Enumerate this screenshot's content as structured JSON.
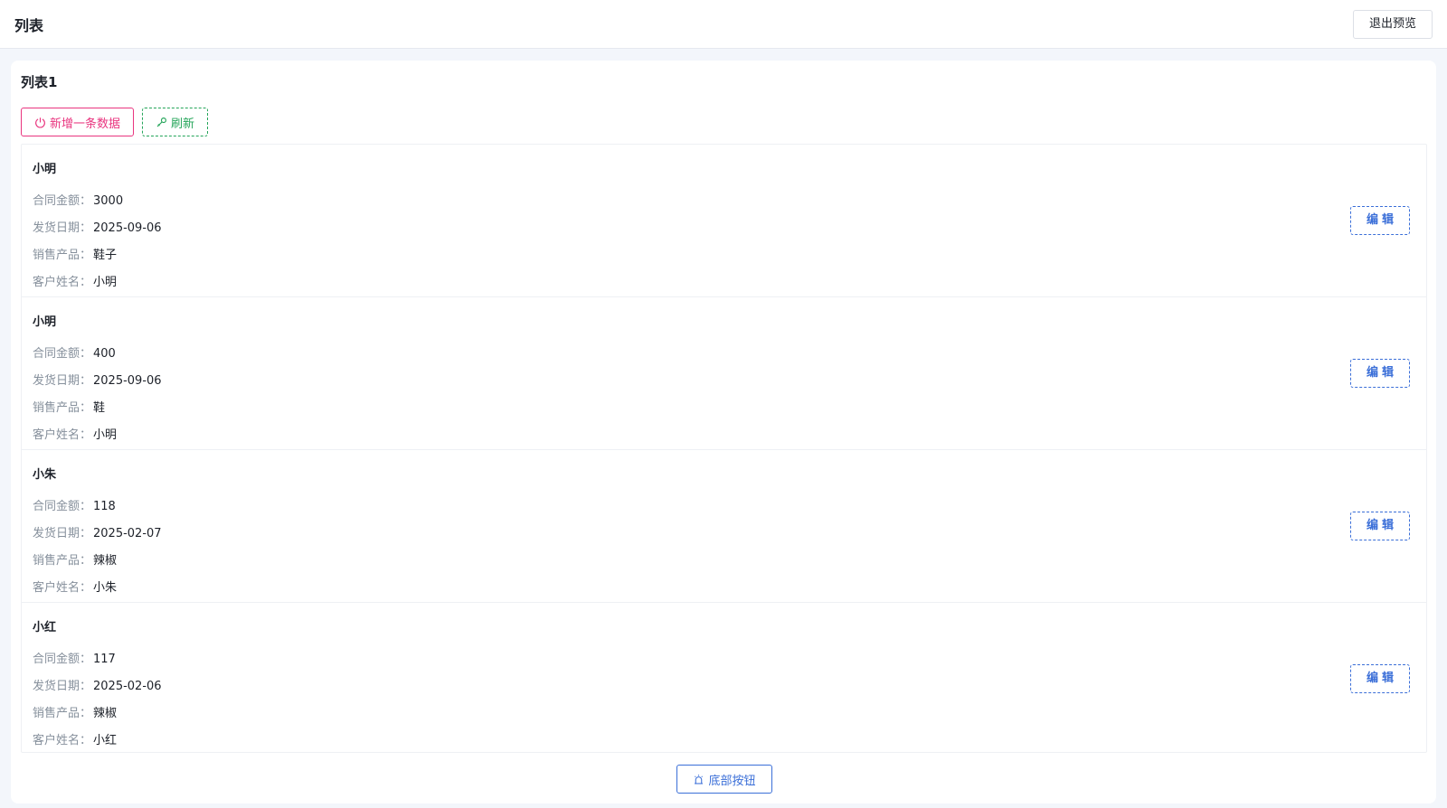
{
  "header": {
    "title": "列表",
    "exit_label": "退出预览"
  },
  "panel": {
    "title": "列表1",
    "add_label": "新增一条数据",
    "refresh_label": "刷新",
    "bottom_label": "底部按钮",
    "edit_label": "编辑"
  },
  "field_labels": {
    "amount": "合同金额：",
    "date": "发货日期：",
    "product": "销售产品：",
    "customer": "客户姓名："
  },
  "items": [
    {
      "name": "小明",
      "amount": "3000",
      "date": "2025-09-06",
      "product": "鞋子",
      "customer": "小明"
    },
    {
      "name": "小明",
      "amount": "400",
      "date": "2025-09-06",
      "product": "鞋",
      "customer": "小明"
    },
    {
      "name": "小朱",
      "amount": "118",
      "date": "2025-02-07",
      "product": "辣椒",
      "customer": "小朱"
    },
    {
      "name": "小红",
      "amount": "117",
      "date": "2025-02-06",
      "product": "辣椒",
      "customer": "小红"
    }
  ],
  "icons": {
    "add": "power-icon",
    "refresh": "wrench-icon",
    "bottom": "alarm-icon"
  },
  "colors": {
    "add": "#e9357f",
    "refresh": "#25a55a",
    "primary": "#3b6fd8"
  }
}
